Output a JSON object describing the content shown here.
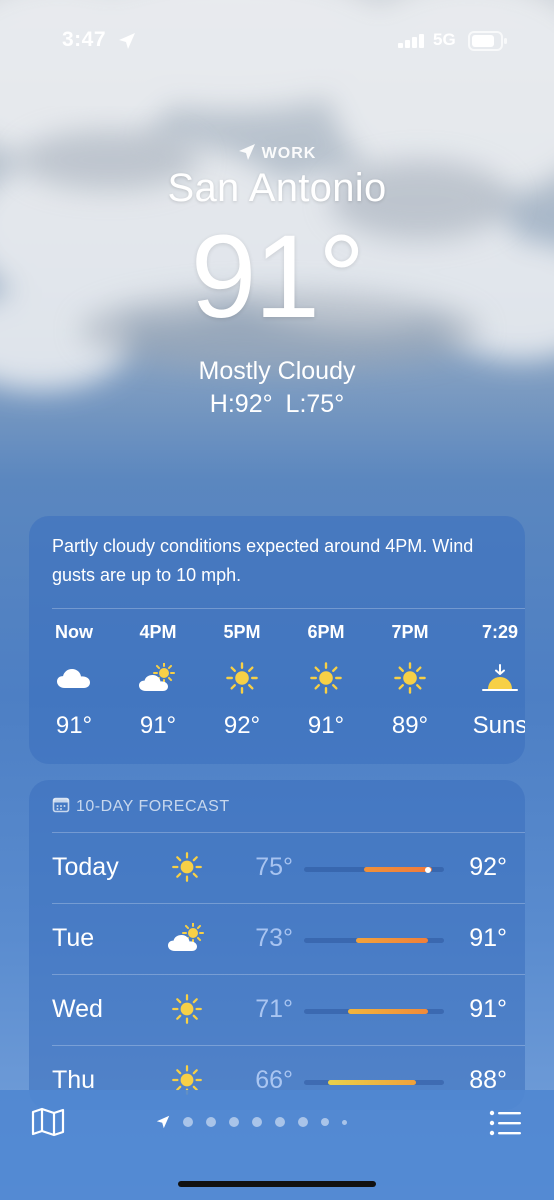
{
  "status_bar": {
    "time": "3:47",
    "network": "5G"
  },
  "location": {
    "tag": "WORK",
    "city": "San Antonio",
    "temperature": "91°",
    "condition": "Mostly Cloudy",
    "high_low": "H:92° L:75°"
  },
  "hourly": {
    "summary": "Partly cloudy conditions expected around 4PM. Wind gusts are up to 10 mph.",
    "items": [
      {
        "label": "Now",
        "icon": "cloud-icon",
        "temp": "91°"
      },
      {
        "label": "4PM",
        "icon": "partly-sunny-icon",
        "temp": "91°"
      },
      {
        "label": "5PM",
        "icon": "sun-icon",
        "temp": "92°"
      },
      {
        "label": "6PM",
        "icon": "sun-icon",
        "temp": "91°"
      },
      {
        "label": "7PM",
        "icon": "sun-icon",
        "temp": "89°"
      },
      {
        "label": "7:29",
        "icon": "sunset-icon",
        "temp": "Suns"
      }
    ]
  },
  "daily": {
    "header": "10-DAY FORECAST",
    "range_min": 60,
    "range_max": 95,
    "items": [
      {
        "day": "Today",
        "icon": "sun-icon",
        "low": "75°",
        "high": "92°",
        "low_val": 75,
        "high_val": 92,
        "current_val": 91,
        "gradient": [
          "#f0913a",
          "#f07a3c"
        ]
      },
      {
        "day": "Tue",
        "icon": "partly-sunny-icon",
        "low": "73°",
        "high": "91°",
        "low_val": 73,
        "high_val": 91,
        "gradient": [
          "#f2a33c",
          "#f07f3a"
        ]
      },
      {
        "day": "Wed",
        "icon": "sun-icon",
        "low": "71°",
        "high": "91°",
        "low_val": 71,
        "high_val": 91,
        "gradient": [
          "#f2b53c",
          "#f08a3a"
        ]
      },
      {
        "day": "Thu",
        "icon": "sun-icon",
        "low": "66°",
        "high": "88°",
        "low_val": 66,
        "high_val": 88,
        "gradient": [
          "#e9d14a",
          "#f0a03a"
        ]
      }
    ]
  },
  "pager": {
    "count": 9,
    "active_index": 0
  }
}
